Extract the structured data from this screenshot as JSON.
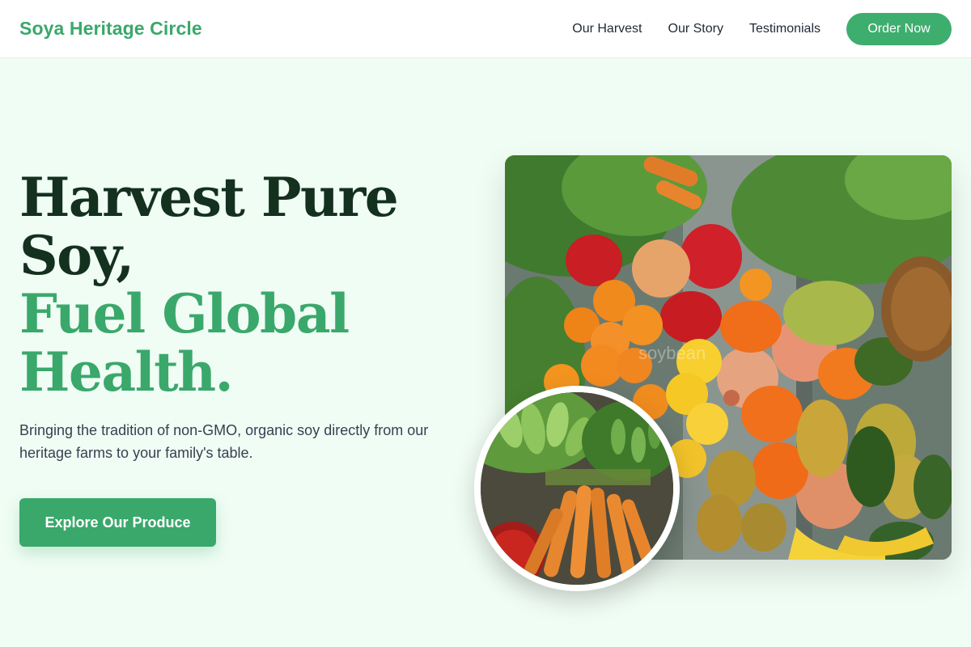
{
  "nav": {
    "brand": "Soya Heritage Circle",
    "links": [
      "Our Harvest",
      "Our Story",
      "Testimonials"
    ],
    "cta": "Order Now"
  },
  "hero": {
    "headline_line1": "Harvest Pure",
    "headline_line2": "Soy,",
    "headline_line3": "Fuel Global",
    "headline_line4": "Health.",
    "subtext": "Bringing the tradition of non-GMO, organic soy directly from our heritage farms to your family's table.",
    "cta": "Explore Our Produce"
  },
  "images": {
    "main_alt": "Assorted fresh vegetables and fruits",
    "circle_alt": "Market baskets of cucumbers and carrots",
    "watermark": "soybean"
  },
  "colors": {
    "accent": "#3aa86b",
    "dark_text": "#14301f",
    "background": "#f0fdf4"
  }
}
